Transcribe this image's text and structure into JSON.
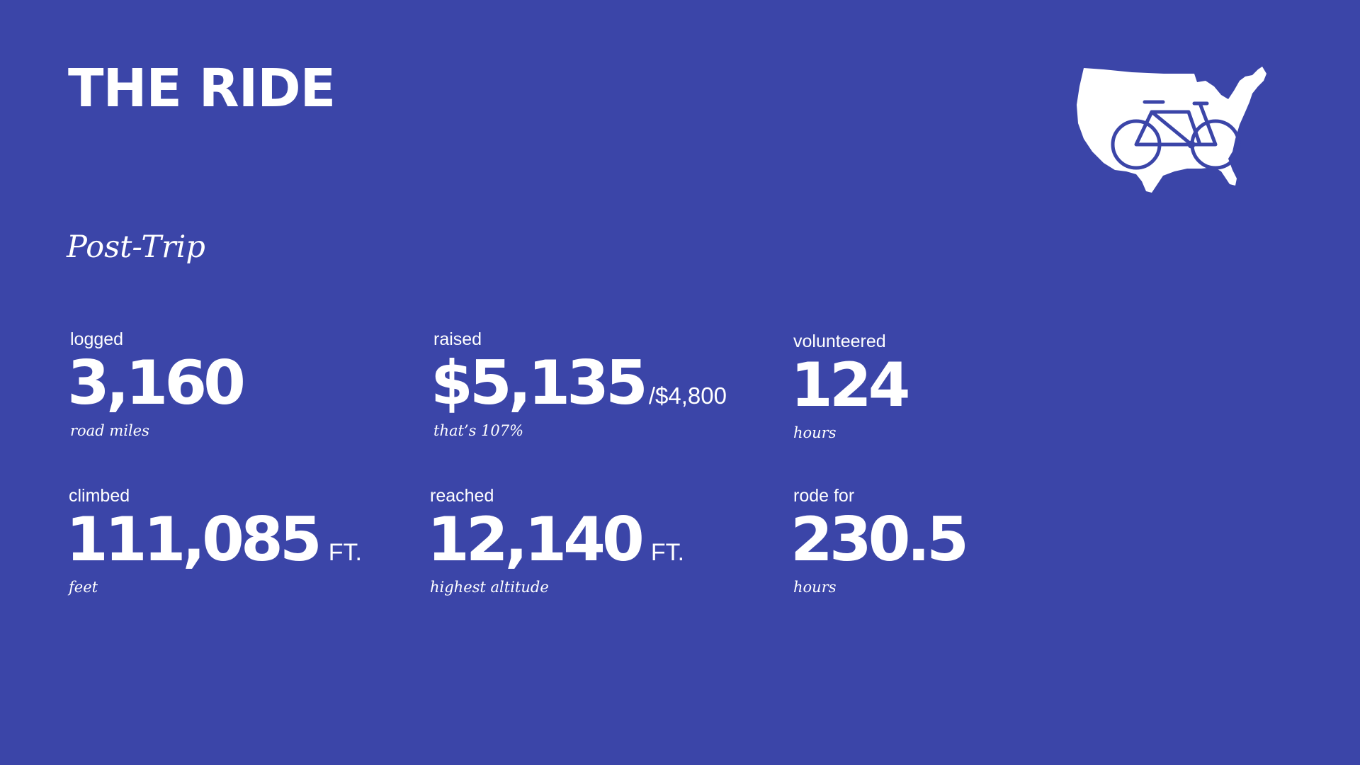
{
  "title": "THE RIDE",
  "subtitle": "Post-Trip",
  "logo": {
    "icon": "usa-map-bicycle-icon",
    "color": "#ffffff"
  },
  "colors": {
    "background": "#3b45a8",
    "text": "#ffffff"
  },
  "stats": {
    "logged": {
      "label": "logged",
      "value": "3,160",
      "note": "road miles"
    },
    "raised": {
      "label": "raised",
      "value": "$5,135",
      "suffix": "/$4,800",
      "note": "that’s 107%"
    },
    "volunteered": {
      "label": "volunteered",
      "value": "124",
      "note": "hours"
    },
    "climbed": {
      "label": "climbed",
      "value": "111,085",
      "unit": "FT.",
      "note": "feet"
    },
    "reached": {
      "label": "reached",
      "value": "12,140",
      "unit": "FT.",
      "note": "highest altitude"
    },
    "rode": {
      "label": "rode for",
      "value": "230.5",
      "note": "hours"
    }
  }
}
